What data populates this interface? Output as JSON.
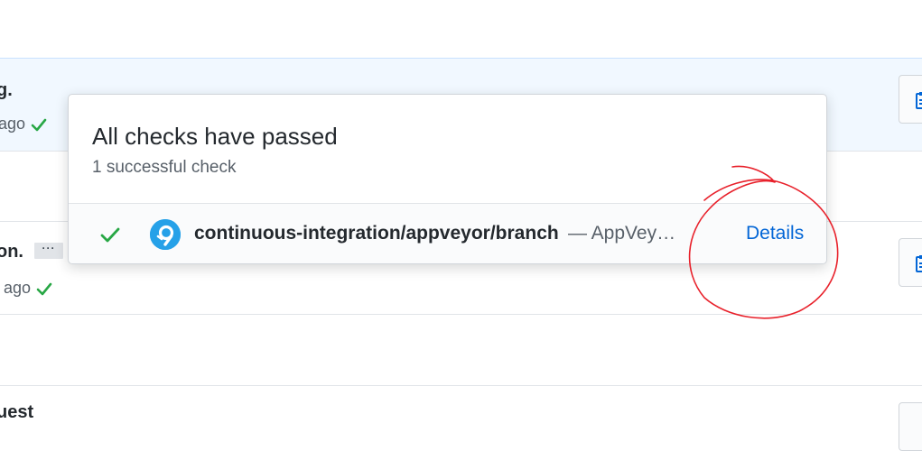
{
  "commits": [
    {
      "title": "g.",
      "meta_text": "ago",
      "status": "success"
    },
    {
      "title": "on.",
      "meta_text": "ago",
      "status": "success",
      "ellipsis": "···"
    },
    {
      "title": "uest"
    }
  ],
  "popover": {
    "title": "All checks have passed",
    "subtitle": "1 successful check",
    "check": {
      "status": "success",
      "provider_icon": "appveyor-icon",
      "context": "continuous-integration/appveyor/branch",
      "description": "— AppVey…",
      "details_label": "Details"
    }
  },
  "colors": {
    "success": "#28a745",
    "link": "#0366d6",
    "annotation": "#e8212b",
    "appveyor": "#26a1e8"
  }
}
